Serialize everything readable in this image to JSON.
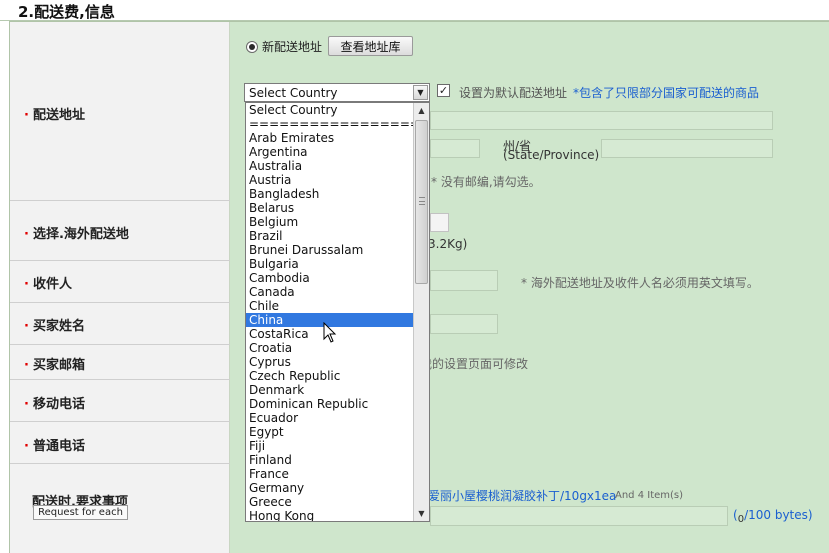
{
  "section": {
    "title": "2.配送费,信息"
  },
  "labels": {
    "address": "配送地址",
    "overseas": "选择.海外配送地",
    "recipient": "收件人",
    "buyer_name": "买家姓名",
    "buyer_email": "买家邮箱",
    "mobile": "移动电话",
    "phone": "普通电话",
    "request": "配送时,要求事项",
    "request_button": "Request for each"
  },
  "address": {
    "radio_new": "新配送地址",
    "view_address_book": "查看地址库",
    "default_checkbox_label": "设置为默认配送地址",
    "restricted_notice": "*包含了只限部分国家可配送的商品",
    "state_label": "州/省",
    "state_label_en": "(State/Province)",
    "no_zip_hint": "* 没有邮编,请勾选。"
  },
  "shipping": {
    "weight_fragment": "3.2Kg)"
  },
  "recipient": {
    "english_hint": "* 海外配送地址及收件人名必须用英文填写。"
  },
  "email": {
    "settings_hint": "我的设置页面可修改"
  },
  "request": {
    "product_link": "爱丽小屋樱桃润凝胶补丁/10gx1ea",
    "item_count": "And 4 Item(s)",
    "byte_open": "(",
    "byte_used": "0",
    "byte_rest": "/100 bytes)"
  },
  "country_select": {
    "value": "Select Country",
    "selected_option": "China",
    "options": [
      "Select Country",
      "==================",
      "Arab Emirates",
      "Argentina",
      "Australia",
      "Austria",
      "Bangladesh",
      "Belarus",
      "Belgium",
      "Brazil",
      "Brunei Darussalam",
      "Bulgaria",
      "Cambodia",
      "Canada",
      "Chile",
      "China",
      "CostaRica",
      "Croatia",
      "Cyprus",
      "Czech Republic",
      "Denmark",
      "Dominican Republic",
      "Ecuador",
      "Egypt",
      "Fiji",
      "Finland",
      "France",
      "Germany",
      "Greece",
      "Hong Kong"
    ]
  },
  "icons": {
    "dropdown": "chevron-down-icon",
    "check": "checkmark-icon",
    "cursor": "mouse-pointer-icon"
  },
  "colors": {
    "accent_link": "#1a5fd0",
    "required_dot": "#e00000",
    "selected_option": "#3178e0",
    "content_bg": "#cfe6cc"
  }
}
